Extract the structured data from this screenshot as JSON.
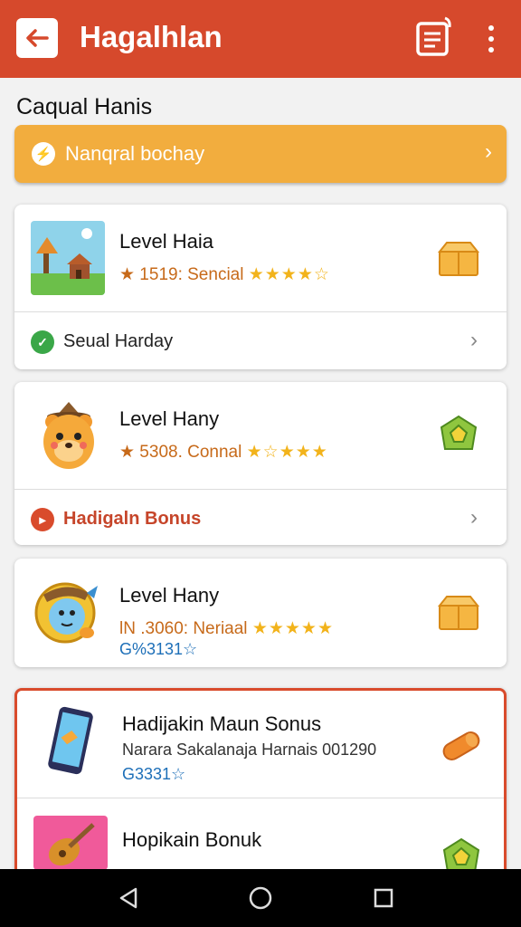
{
  "appbar": {
    "title": "Hagalhlan",
    "back_icon": "arrow-left-icon",
    "notes_icon": "notepad-icon",
    "more_icon": "more-vertical-icon",
    "color": "#d6492c"
  },
  "section": {
    "title": "Caqual Hanis"
  },
  "banner": {
    "label": "Nanqral bochay",
    "icon": "lightning-icon",
    "color": "#f2ad3e"
  },
  "cards": [
    {
      "title": "Level Haia",
      "meta_prefix": "★ 1519: Sencial",
      "stars": "★★★★☆",
      "reward_icon": "treasure-box-icon",
      "footer": {
        "label": "Seual Harday",
        "icon": "check-circle-icon",
        "color": "#3aa748"
      }
    },
    {
      "title": "Level Hany",
      "meta_prefix": "★ 5308. Connal",
      "stars": "★☆★★★",
      "reward_icon": "green-gem-icon",
      "footer": {
        "label": "Hadigaln Bonus",
        "icon": "play-circle-icon",
        "color": "#d94b2c"
      }
    },
    {
      "title": "Level Hany",
      "meta_prefix": "lN .3060: Neriaal",
      "stars": "★★★★★",
      "code": "G%3131☆",
      "reward_icon": "treasure-box-icon"
    },
    {
      "title": "Hadijakin Maun Sonus",
      "meta_prefix": "Narara Sakalanaja Harnais 001290",
      "code": "G3331☆",
      "reward_icon": "orange-capsule-icon"
    },
    {
      "title": "Hopikain Bonuk",
      "reward_icon": "green-gem-icon"
    }
  ],
  "navbar": {
    "back_icon": "nav-back-icon",
    "home_icon": "nav-home-icon",
    "recents_icon": "nav-recents-icon"
  }
}
